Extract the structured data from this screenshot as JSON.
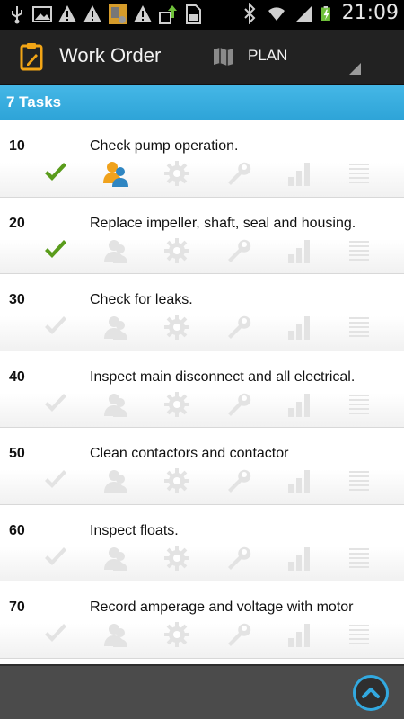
{
  "status_bar": {
    "time": "21:09",
    "left_icons": [
      "usb-icon",
      "image-icon",
      "warning-icon",
      "warning-icon",
      "app-icon",
      "warning-icon",
      "upload-icon",
      "sd-card-icon"
    ],
    "right_icons": [
      "bluetooth-icon",
      "wifi-icon",
      "signal-icon",
      "battery-charging-icon"
    ]
  },
  "action_bar": {
    "title": "Work Order",
    "plan_label": "PLAN",
    "app_icon": "clipboard-icon",
    "plan_icon": "map-icon"
  },
  "tasks_header": {
    "label": "7 Tasks"
  },
  "tasks": [
    {
      "number": "10",
      "title": "Check pump operation.",
      "completed": true,
      "has_labor": true
    },
    {
      "number": "20",
      "title": "Replace impeller, shaft, seal and housing.",
      "completed": true,
      "has_labor": false
    },
    {
      "number": "30",
      "title": "Check for leaks.",
      "completed": false,
      "has_labor": false
    },
    {
      "number": "40",
      "title": "Inspect main disconnect and all electrical.",
      "completed": false,
      "has_labor": false
    },
    {
      "number": "50",
      "title": "Clean contactors and contactor",
      "completed": false,
      "has_labor": false
    },
    {
      "number": "60",
      "title": "Inspect floats.",
      "completed": false,
      "has_labor": false
    },
    {
      "number": "70",
      "title": "Record amperage and voltage with motor",
      "completed": false,
      "has_labor": false
    }
  ],
  "colors": {
    "accent": "#2ea4d8",
    "check_active": "#5a9c1c",
    "icon_inactive": "#e3e3e3",
    "action_bar": "#222222",
    "bottom_bar": "#4b4b4b"
  },
  "bottom_bar": {
    "scroll_up_icon": "chevron-up-icon"
  }
}
